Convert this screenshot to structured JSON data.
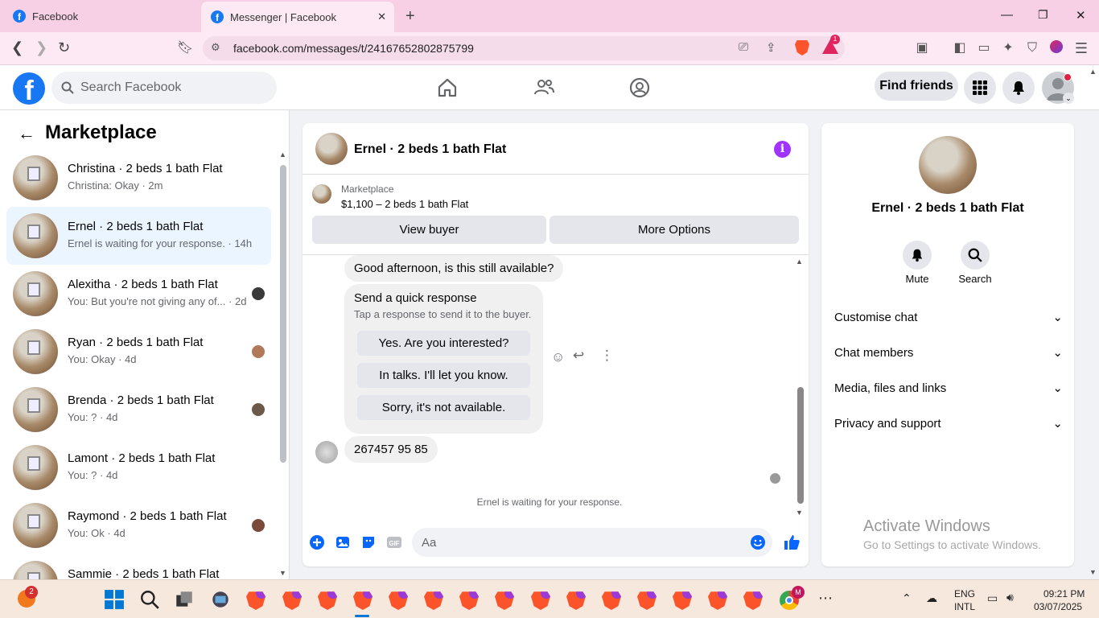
{
  "browser": {
    "tabs": [
      {
        "title": "Facebook"
      },
      {
        "title": "Messenger | Facebook"
      }
    ],
    "url": "facebook.com/messages/t/24167652802875799",
    "rewards_badge": "1"
  },
  "header": {
    "search_placeholder": "Search Facebook",
    "find_friends": "Find friends"
  },
  "sidebar": {
    "title": "Marketplace",
    "conversations": [
      {
        "name": "Christina · 2 beds 1 bath Flat",
        "preview": "Christina: Okay · 2m"
      },
      {
        "name": "Ernel · 2 beds 1 bath Flat",
        "preview": "Ernel is waiting for your response. · 14h"
      },
      {
        "name": "Alexitha · 2 beds 1 bath Flat",
        "preview": "You: But you're not giving any of... · 2d"
      },
      {
        "name": "Ryan · 2 beds 1 bath Flat",
        "preview": "You: Okay · 4d"
      },
      {
        "name": "Brenda · 2 beds 1 bath Flat",
        "preview": "You: ? · 4d"
      },
      {
        "name": "Lamont · 2 beds 1 bath Flat",
        "preview": "You: ? · 4d"
      },
      {
        "name": "Raymond · 2 beds 1 bath Flat",
        "preview": "You: Ok · 4d"
      },
      {
        "name": "Sammie · 2 beds 1 bath Flat",
        "preview": ""
      }
    ]
  },
  "chat": {
    "title": "Ernel · 2 beds 1 bath Flat",
    "listing_label": "Marketplace",
    "listing_price": "$1,100 – 2 beds 1 bath Flat",
    "view_buyer": "View buyer",
    "more_options": "More Options",
    "messages": {
      "first": "Good afternoon, is this still available?",
      "quick_title": "Send a quick response",
      "quick_sub": "Tap a response to send it to the buyer.",
      "quick_replies": [
        "Yes. Are you interested?",
        "In talks. I'll let you know.",
        "Sorry, it's not available."
      ],
      "number": "267457 95 85"
    },
    "waiting": "Ernel is waiting for your response.",
    "composer_placeholder": "Aa"
  },
  "details": {
    "name": "Ernel · 2 beds 1 bath Flat",
    "mute": "Mute",
    "search": "Search",
    "sections": [
      "Customise chat",
      "Chat members",
      "Media, files and links",
      "Privacy and support"
    ]
  },
  "watermark": {
    "line1": "Activate Windows",
    "line2": "Go to Settings to activate Windows."
  },
  "taskbar": {
    "notif_badge": "2",
    "lang1": "ENG",
    "lang2": "INTL",
    "time": "09:21 PM",
    "date": "03/07/2025",
    "chrome_badge": "M"
  },
  "colors": {
    "facebook_blue": "#1877f2",
    "selected_row": "#ebf5ff",
    "info_purple": "#a033ff"
  }
}
